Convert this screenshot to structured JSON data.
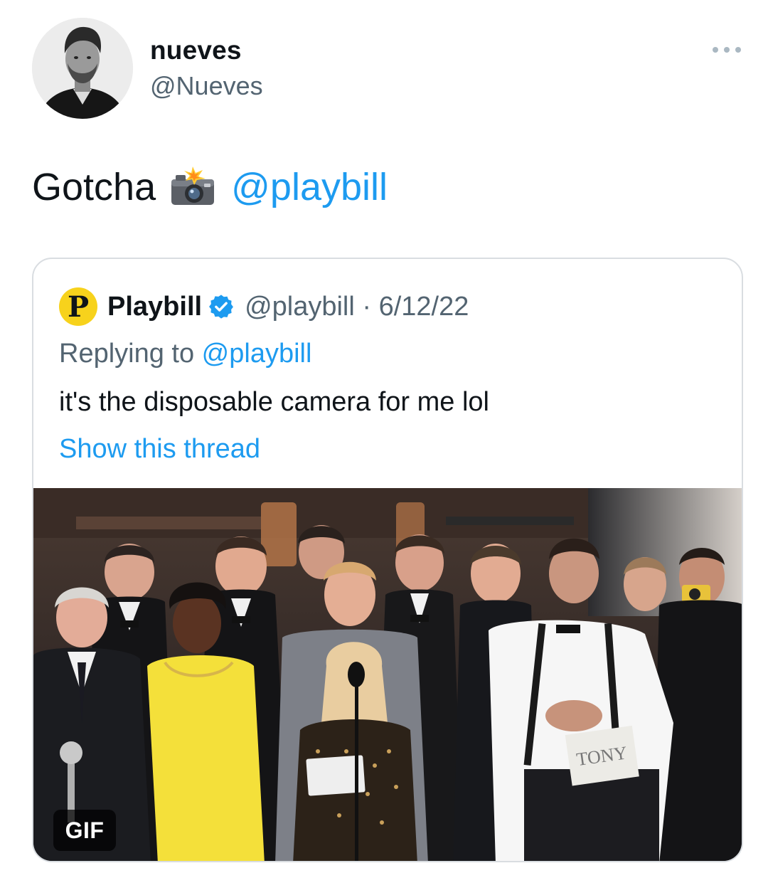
{
  "author": {
    "display_name": "nueves",
    "handle": "@Nueves",
    "avatar_icon": "profile-photo-icon"
  },
  "more_icon": "more-horizontal-icon",
  "tweet": {
    "text_prefix": "Gotcha",
    "emoji": "camera-with-flash-icon",
    "mention": "@playbill"
  },
  "quoted_tweet": {
    "logo_letter": "P",
    "name": "Playbill",
    "verified_icon": "verified-badge-icon",
    "handle_date": "@playbill · 6/12/22",
    "replying_prefix": "Replying to ",
    "replying_mention": "@playbill",
    "text": "it's the disposable camera for me lol",
    "show_thread": "Show this thread",
    "media_badge": "GIF",
    "media_sign_text": "TONY"
  },
  "colors": {
    "link": "#1d9bf0",
    "secondary_text": "#536471",
    "border": "#d9dde1",
    "playbill_yellow": "#f7d21c"
  }
}
